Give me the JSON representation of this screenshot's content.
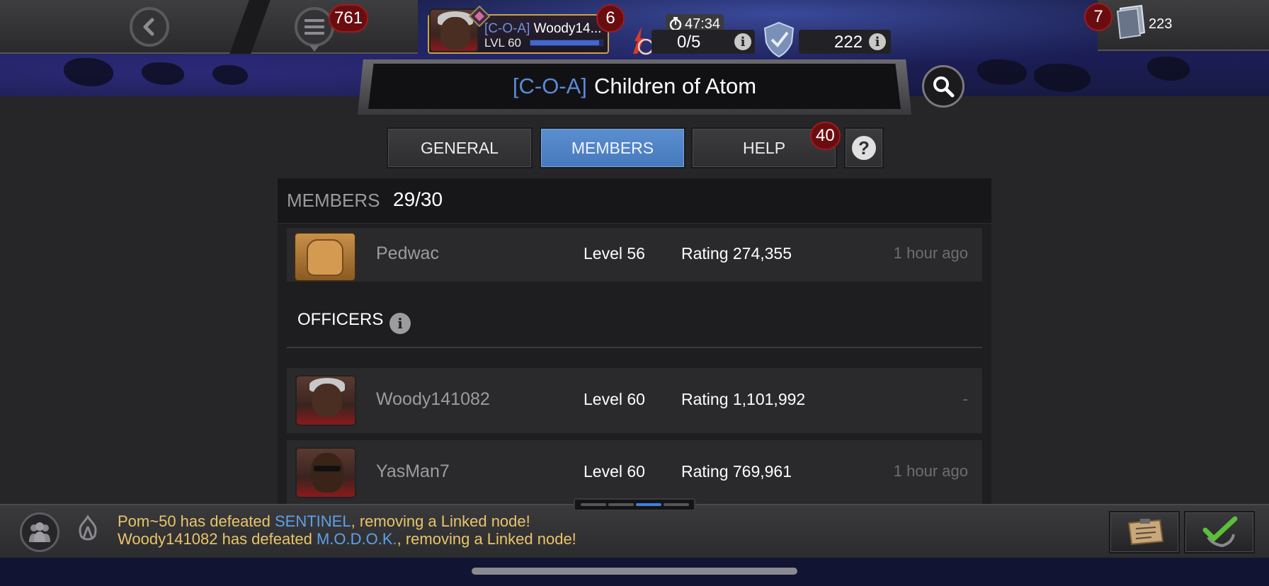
{
  "topbar": {
    "menu_badge": "761",
    "profile": {
      "alliance_tag": "[C-O-A]",
      "name": "Woody14...",
      "level": "LVL 60",
      "xp_fraction": 0.95,
      "badge": "6"
    },
    "timer": "47:34",
    "energy": "0/5",
    "shield_value": "222",
    "units_badge": "7",
    "units_value": "223"
  },
  "alliance": {
    "tag": "[C-O-A]",
    "name": "Children of Atom"
  },
  "tabs": [
    {
      "label": "GENERAL",
      "active": false
    },
    {
      "label": "MEMBERS",
      "active": true
    },
    {
      "label": "HELP",
      "active": false
    }
  ],
  "help_badge": "40",
  "members_panel": {
    "header_label": "MEMBERS",
    "count": "29/30",
    "officers_label": "OFFICERS",
    "rows": [
      {
        "name": "Pedwac",
        "level": "Level 56",
        "rating": "Rating 274,355",
        "last_seen": "1 hour ago"
      },
      {
        "name": "Woody141082",
        "level": "Level 60",
        "rating": "Rating 1,101,992",
        "last_seen": "-"
      },
      {
        "name": "YasMan7",
        "level": "Level 60",
        "rating": "Rating 769,961",
        "last_seen": "1 hour ago"
      }
    ]
  },
  "pager": {
    "pages": 4,
    "current": 3
  },
  "news": [
    {
      "pre": "Pom~50 has defeated ",
      "highlight": "SENTINEL",
      "post": ", removing a Linked node!"
    },
    {
      "pre": "Woody141082 has defeated ",
      "highlight": "M.O.D.O.K.",
      "post": ", removing a Linked node!"
    }
  ],
  "colors": {
    "accent_blue": "#4679bd",
    "badge_red": "#6a0d10",
    "news_yellow": "#e9c46a",
    "news_highlight": "#5ea0e8"
  },
  "icons": [
    "back-arrow-icon",
    "menu-icon",
    "timer-icon",
    "energy-icon",
    "shield-icon",
    "units-icon",
    "search-icon",
    "question-icon",
    "info-icon",
    "alliance-icon",
    "war-icon",
    "clipboard-icon",
    "checkmark-icon"
  ]
}
